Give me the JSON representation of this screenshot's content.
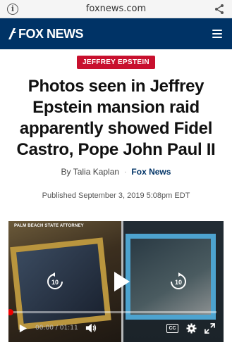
{
  "browser": {
    "url": "foxnews.com",
    "info_icon": "info-icon",
    "share_icon": "share-icon"
  },
  "header": {
    "logo_text": "FOX NEWS",
    "menu_icon": "hamburger-menu-icon",
    "background_color": "#003366"
  },
  "article": {
    "category": "JEFFREY EPSTEIN",
    "category_color": "#c8102e",
    "headline": "Photos seen in Jeffrey Epstein mansion raid apparently showed Fidel Castro, Pope John Paul II",
    "byline_prefix": "By",
    "author": "Talia Kaplan",
    "separator": "·",
    "outlet": "Fox News",
    "published": "Published September 3, 2019 5:08pm EDT"
  },
  "video": {
    "caption_chip": "PALM BEACH STATE ATTORNEY",
    "skip_back_label": "10",
    "skip_forward_label": "10",
    "current_time": "00:00",
    "time_separator": "/",
    "duration": "01:11",
    "cc_label": "CC",
    "progress_fraction": 0.0
  }
}
